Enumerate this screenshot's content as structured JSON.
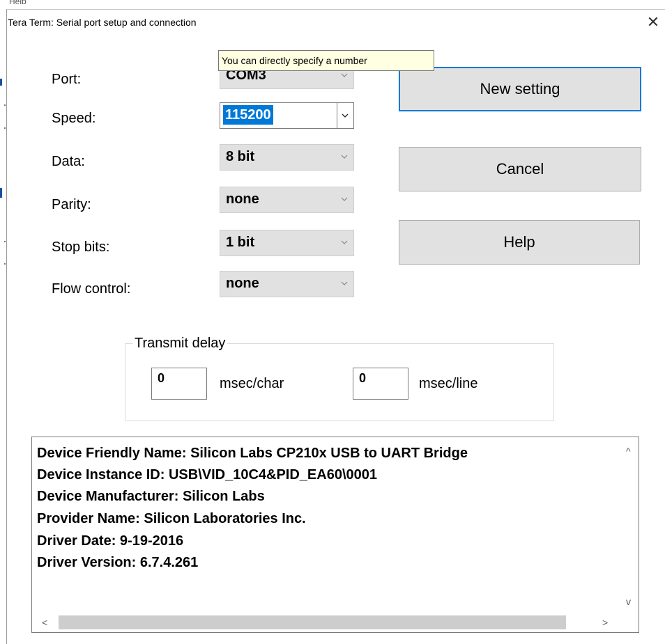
{
  "window": {
    "title": "Tera Term: Serial port setup and connection",
    "close_symbol": "✕"
  },
  "background_fragment": "Help",
  "tooltip": "You can directly specify a number",
  "fields": {
    "port": {
      "label": "Port:",
      "value": "COM3"
    },
    "speed": {
      "label": "Speed:",
      "value": "115200"
    },
    "data": {
      "label": "Data:",
      "value": "8 bit"
    },
    "parity": {
      "label": "Parity:",
      "value": "none"
    },
    "stop_bits": {
      "label": "Stop bits:",
      "value": "1 bit"
    },
    "flow_control": {
      "label": "Flow control:",
      "value": "none"
    }
  },
  "buttons": {
    "new_setting": "New setting",
    "cancel": "Cancel",
    "help": "Help"
  },
  "transmit_delay": {
    "title": "Transmit delay",
    "char_value": "0",
    "char_unit": "msec/char",
    "line_value": "0",
    "line_unit": "msec/line"
  },
  "device_info": [
    "Device Friendly Name: Silicon Labs CP210x USB to UART Bridge",
    "Device Instance ID: USB\\VID_10C4&PID_EA60\\0001",
    "Device Manufacturer: Silicon Labs",
    "Provider Name: Silicon Laboratories Inc.",
    "Driver Date: 9-19-2016",
    "Driver Version: 6.7.4.261"
  ],
  "scroll_arrows": {
    "up": "^",
    "down": "v",
    "left": "<",
    "right": ">"
  },
  "colors": {
    "selection": "#0078d7",
    "default_button_border": "#0078d7",
    "tooltip_bg": "#ffffe1",
    "button_bg": "#e1e1e1"
  },
  "icons": [
    "close-icon",
    "chevron-down-icon",
    "scroll-up-icon",
    "scroll-down-icon",
    "scroll-left-icon",
    "scroll-right-icon"
  ]
}
